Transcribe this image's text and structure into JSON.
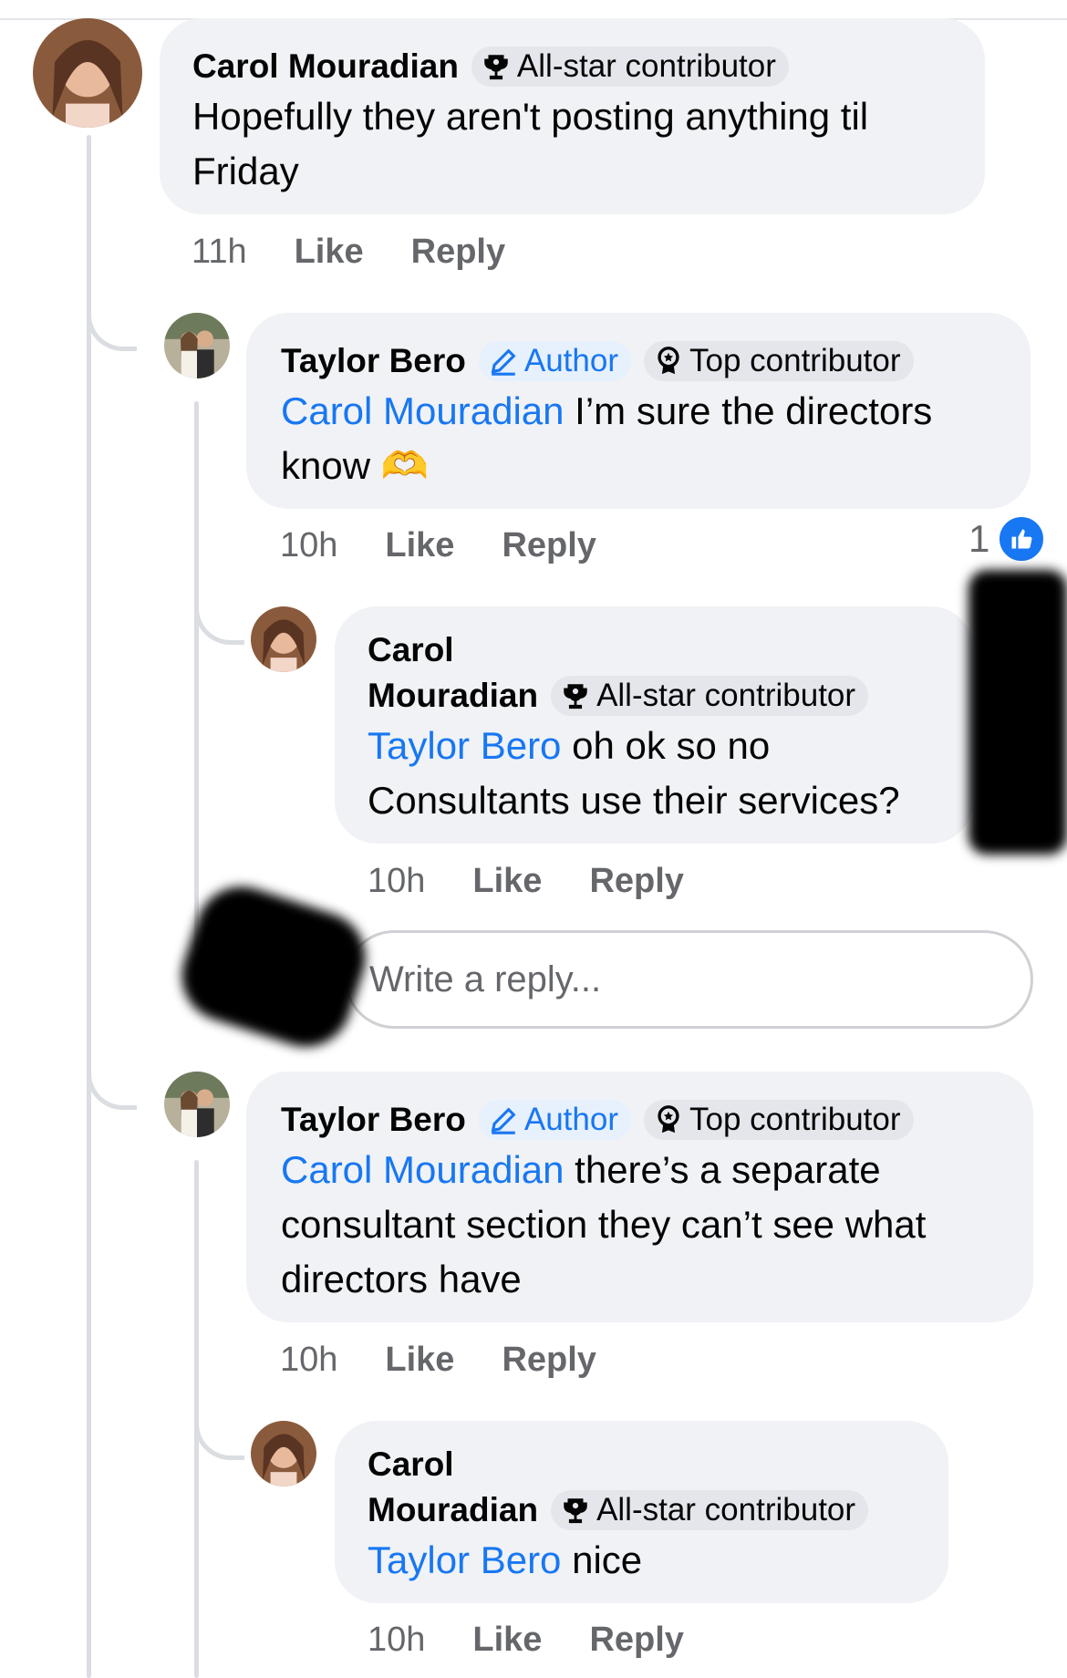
{
  "comments": [
    {
      "author": "Carol Mouradian",
      "badge": "All-star contributor",
      "text": "Hopefully they aren't posting anything til Friday",
      "time": "11h",
      "like": "Like",
      "reply": "Reply"
    },
    {
      "author": "Taylor Bero",
      "author_badge": "Author",
      "badge": "Top contributor",
      "mention": "Carol Mouradian",
      "text": " I’m sure the directors know",
      "emoji": "🫶",
      "time": "10h",
      "like": "Like",
      "reply": "Reply",
      "reaction_count": "1"
    },
    {
      "author_first": "Carol",
      "author_last": "Mouradian",
      "badge": "All-star contributor",
      "mention": "Taylor Bero",
      "text": " oh ok so no Consultants use their services?",
      "time": "10h",
      "like": "Like",
      "reply": "Reply"
    },
    {
      "author": "Taylor Bero",
      "author_badge": "Author",
      "badge": "Top contributor",
      "mention": "Carol Mouradian",
      "text": " there’s a separate consultant section they can’t see what directors have",
      "time": "10h",
      "like": "Like",
      "reply": "Reply"
    },
    {
      "author_first": "Carol",
      "author_last": "Mouradian",
      "badge": "All-star contributor",
      "mention": "Taylor Bero",
      "text": " nice",
      "time": "10h",
      "like": "Like",
      "reply": "Reply"
    }
  ],
  "reply_input": {
    "placeholder": "Write a reply..."
  },
  "colors": {
    "accent": "#1877f2",
    "bubble": "#f0f2f5",
    "meta": "#65676b"
  },
  "icons": {
    "all_star": "trophy-icon",
    "top": "award-icon",
    "author": "pencil-icon",
    "like": "thumbs-up-icon"
  }
}
